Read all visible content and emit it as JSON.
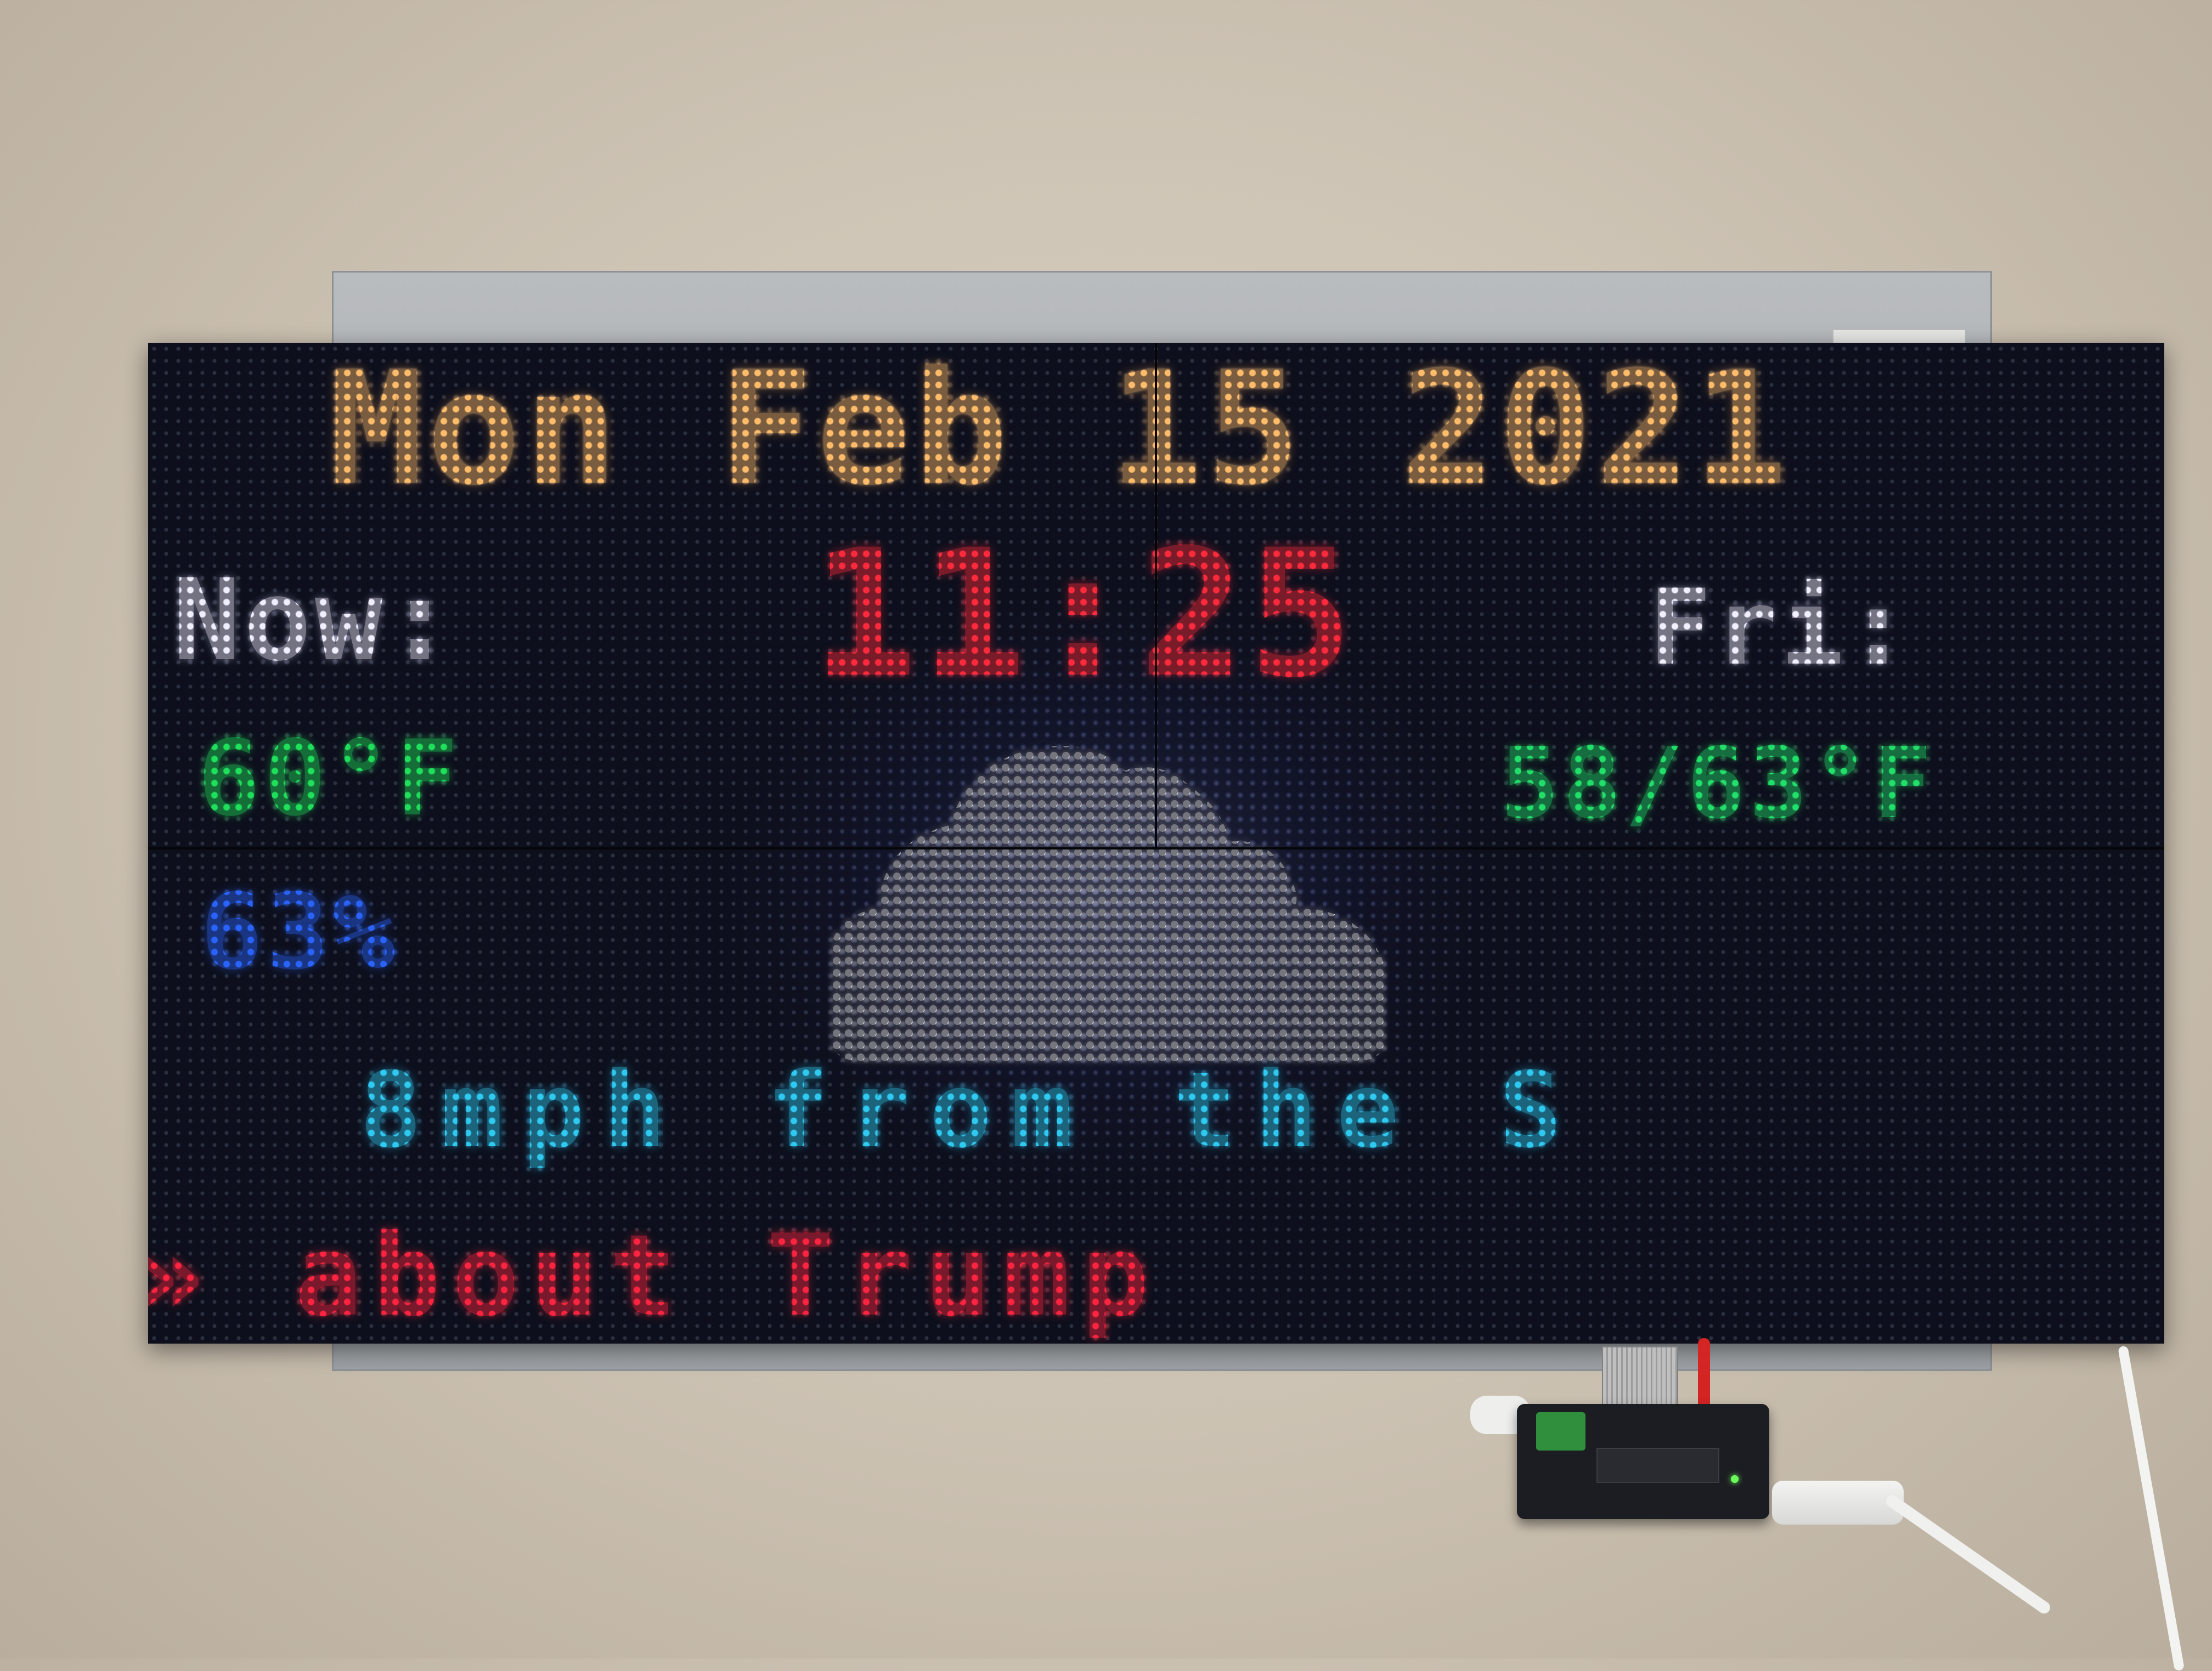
{
  "display": {
    "date": "Mon Feb 15 2021",
    "time": "11:25",
    "now_label": "Now:",
    "now_temp": "60°F",
    "now_humidity": "63%",
    "forecast_label": "Fri:",
    "forecast_temp": "58/63°F",
    "wind": "8mph from the S",
    "news_ticker": "» about Trump"
  },
  "icons": {
    "weather": "cloud-icon"
  },
  "colors": {
    "date": "#ffbd6b",
    "time": "#ff2a3c",
    "labels": "#f0eeff",
    "temperature": "#1ee05a",
    "humidity": "#2a64ff",
    "wind": "#2fcaf2",
    "news": "#ff2440",
    "panel": "#0d0f1c"
  }
}
